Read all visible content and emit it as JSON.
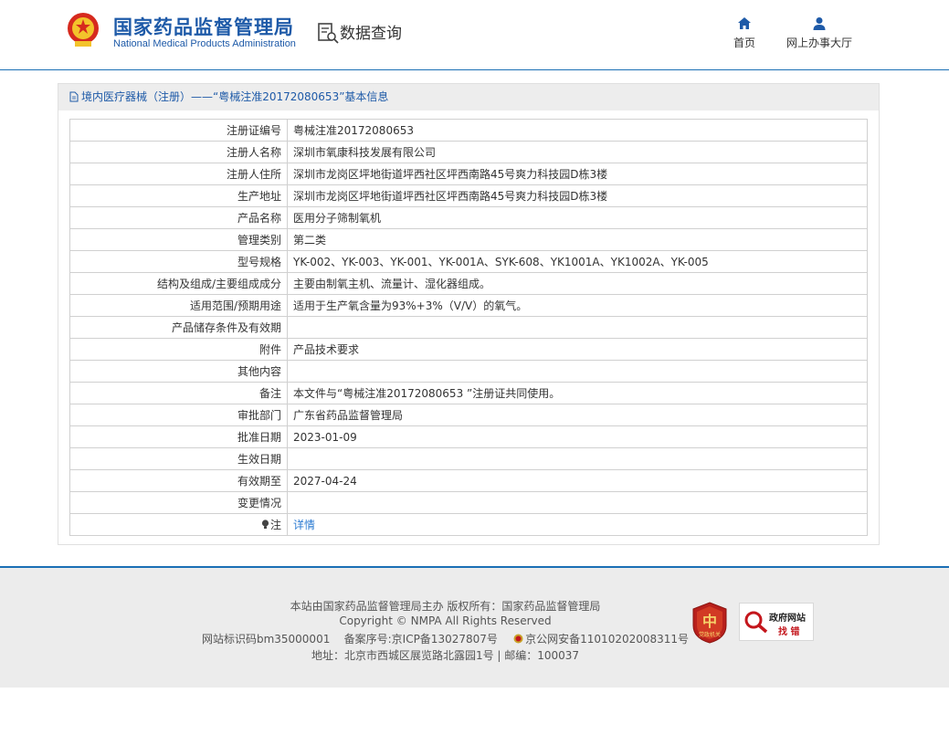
{
  "header": {
    "logo_cn": "国家药品监督管理局",
    "logo_en": "National Medical Products Administration",
    "query_title": "数据查询",
    "nav": [
      {
        "label": "首页",
        "icon": "home-icon"
      },
      {
        "label": "网上办事大厅",
        "icon": "user-icon"
      }
    ]
  },
  "panel": {
    "breadcrumb": "境内医疗器械（注册）——“粤械注准20172080653”基本信息",
    "rows": [
      {
        "key": "注册证编号",
        "value": "粤械注准20172080653"
      },
      {
        "key": "注册人名称",
        "value": "深圳市氧康科技发展有限公司"
      },
      {
        "key": "注册人住所",
        "value": "深圳市龙岗区坪地街道坪西社区坪西南路45号爽力科技园D栋3楼"
      },
      {
        "key": "生产地址",
        "value": "深圳市龙岗区坪地街道坪西社区坪西南路45号爽力科技园D栋3楼"
      },
      {
        "key": "产品名称",
        "value": "医用分子筛制氧机"
      },
      {
        "key": "管理类别",
        "value": "第二类"
      },
      {
        "key": "型号规格",
        "value": "YK-002、YK-003、YK-001、YK-001A、SYK-608、YK1001A、YK1002A、YK-005"
      },
      {
        "key": "结构及组成/主要组成成分",
        "value": "主要由制氧主机、流量计、湿化器组成。"
      },
      {
        "key": "适用范围/预期用途",
        "value": "适用于生产氧含量为93%+3%（V/V）的氧气。"
      },
      {
        "key": "产品储存条件及有效期",
        "value": ""
      },
      {
        "key": "附件",
        "value": "产品技术要求"
      },
      {
        "key": "其他内容",
        "value": ""
      },
      {
        "key": "备注",
        "value": "本文件与“粤械注准20172080653 ”注册证共同使用。"
      },
      {
        "key": "审批部门",
        "value": "广东省药品监督管理局"
      },
      {
        "key": "批准日期",
        "value": "2023-01-09"
      },
      {
        "key": "生效日期",
        "value": ""
      },
      {
        "key": "有效期至",
        "value": "2027-04-24"
      },
      {
        "key": "变更情况",
        "value": ""
      }
    ],
    "note_key": "注",
    "note_link": "详情"
  },
  "footer": {
    "line1": "本站由国家药品监督管理局主办 版权所有：国家药品监督管理局",
    "line2": "Copyright © NMPA All Rights Reserved",
    "site_id": "网站标识码bm35000001",
    "icp": "备案序号:京ICP备13027807号",
    "gongan": "京公网安备11010202008311号",
    "line4": "地址：北京市西城区展览路北露园1号 | 邮编：100037",
    "party_badge_text": "党政机关",
    "jiucuo_title": "政府网站",
    "jiucuo_sub": "找 错"
  },
  "colors": {
    "brand_blue": "#1e5aa8",
    "link_blue": "#2a7ad2",
    "header_rule": "#1a6fb5"
  }
}
